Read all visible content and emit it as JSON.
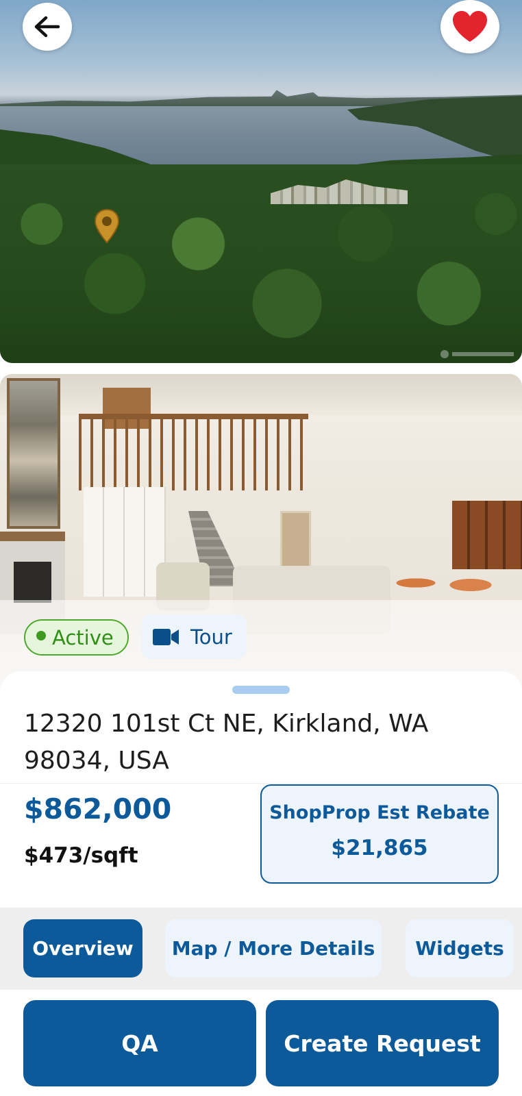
{
  "header": {
    "back_icon": "arrow-left-icon",
    "favorite_icon": "heart-icon",
    "favorite_color": "#e3232e"
  },
  "photos": {
    "aerial_alt": "aerial-view-photo",
    "interior_alt": "living-room-photo"
  },
  "status": {
    "label": "Active",
    "color": "#3b9a1f"
  },
  "tour": {
    "label": "Tour",
    "icon": "video-camera-icon"
  },
  "listing": {
    "address": "12320 101st Ct NE, Kirkland, WA 98034, USA",
    "price": "$862,000",
    "price_per_sqft": "$473/sqft"
  },
  "rebate": {
    "label": "ShopProp Est Rebate",
    "value": "$21,865"
  },
  "tabs": [
    {
      "label": "Overview",
      "active": true
    },
    {
      "label": "Map / More Details",
      "active": false
    },
    {
      "label": "Widgets",
      "active": false
    }
  ],
  "actions": {
    "qa_label": "QA",
    "create_request_label": "Create Request"
  },
  "colors": {
    "brand_blue": "#0d5a9a",
    "light_blue_bg": "#eef4fb",
    "active_green": "#4ea82c"
  }
}
